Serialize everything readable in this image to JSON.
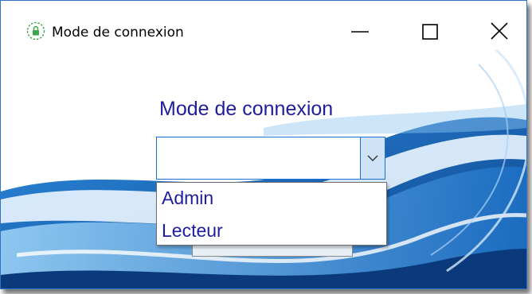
{
  "window": {
    "title": "Mode de connexion",
    "app_icon": "lock-icon",
    "controls": [
      "minimize-icon",
      "maximize-icon",
      "close-icon"
    ]
  },
  "form": {
    "label": "Mode de connexion",
    "combo_value": "",
    "options": [
      "Admin",
      "Lecteur"
    ]
  },
  "colors": {
    "accent": "#1a6fd4",
    "label_text": "#1d1d9e",
    "background_swoosh": "#0f5fb2"
  }
}
